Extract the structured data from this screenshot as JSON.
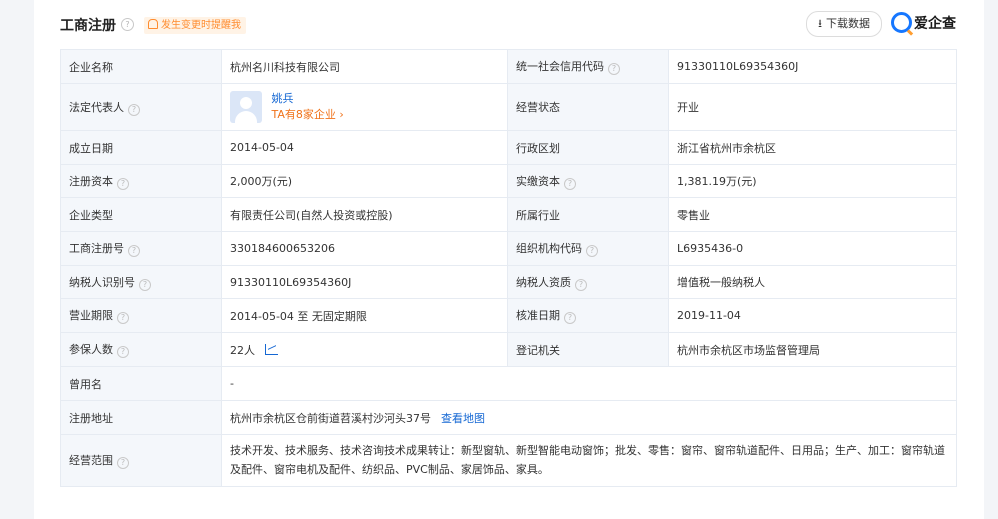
{
  "header": {
    "title": "工商注册",
    "notice": "发生变更时提醒我",
    "download_label": "下载数据",
    "logo_text": "爱企查"
  },
  "rows": {
    "r1": {
      "l1": "企业名称",
      "v1": "杭州名川科技有限公司",
      "l2": "统一社会信用代码",
      "v2": "91330110L69354360J"
    },
    "r2": {
      "l1": "法定代表人",
      "rep_name": "姚兵",
      "rep_companies": "TA有8家企业 ›",
      "l2": "经营状态",
      "v2": "开业"
    },
    "r3": {
      "l1": "成立日期",
      "v1": "2014-05-04",
      "l2": "行政区划",
      "v2": "浙江省杭州市余杭区"
    },
    "r4": {
      "l1": "注册资本",
      "v1": "2,000万(元)",
      "l2": "实缴资本",
      "v2": "1,381.19万(元)"
    },
    "r5": {
      "l1": "企业类型",
      "v1": "有限责任公司(自然人投资或控股)",
      "l2": "所属行业",
      "v2": "零售业"
    },
    "r6": {
      "l1": "工商注册号",
      "v1": "330184600653206",
      "l2": "组织机构代码",
      "v2": "L6935436-0"
    },
    "r7": {
      "l1": "纳税人识别号",
      "v1": "91330110L69354360J",
      "l2": "纳税人资质",
      "v2": "增值税一般纳税人"
    },
    "r8": {
      "l1": "营业期限",
      "v1": "2014-05-04 至 无固定期限",
      "l2": "核准日期",
      "v2": "2019-11-04"
    },
    "r9": {
      "l1": "参保人数",
      "v1": "22人",
      "l2": "登记机关",
      "v2": "杭州市余杭区市场监督管理局"
    },
    "r10": {
      "l1": "曾用名",
      "v1": "-"
    },
    "r11": {
      "l1": "注册地址",
      "v1": "杭州市余杭区仓前街道苕溪村沙河头37号",
      "link": "查看地图"
    },
    "r12": {
      "l1": "经营范围",
      "v1": "技术开发、技术服务、技术咨询技术成果转让：新型窗轨、新型智能电动窗饰；批发、零售：窗帘、窗帘轨道配件、日用品；生产、加工：窗帘轨道及配件、窗帘电机及配件、纺织品、PVC制品、家居饰品、家具。"
    }
  },
  "icons": {
    "help": "question-circle-icon",
    "download": "download-arrow-icon",
    "bell": "bell-icon",
    "trend": "trend-chart-icon",
    "logo": "aiqicha-logo-icon"
  },
  "colors": {
    "link": "#1467d3",
    "accent": "#f0721a",
    "notice_bg": "#fff3e6",
    "label_bg": "#f4f7fb",
    "border": "#e6ebf2",
    "brand": "#1677ff"
  }
}
